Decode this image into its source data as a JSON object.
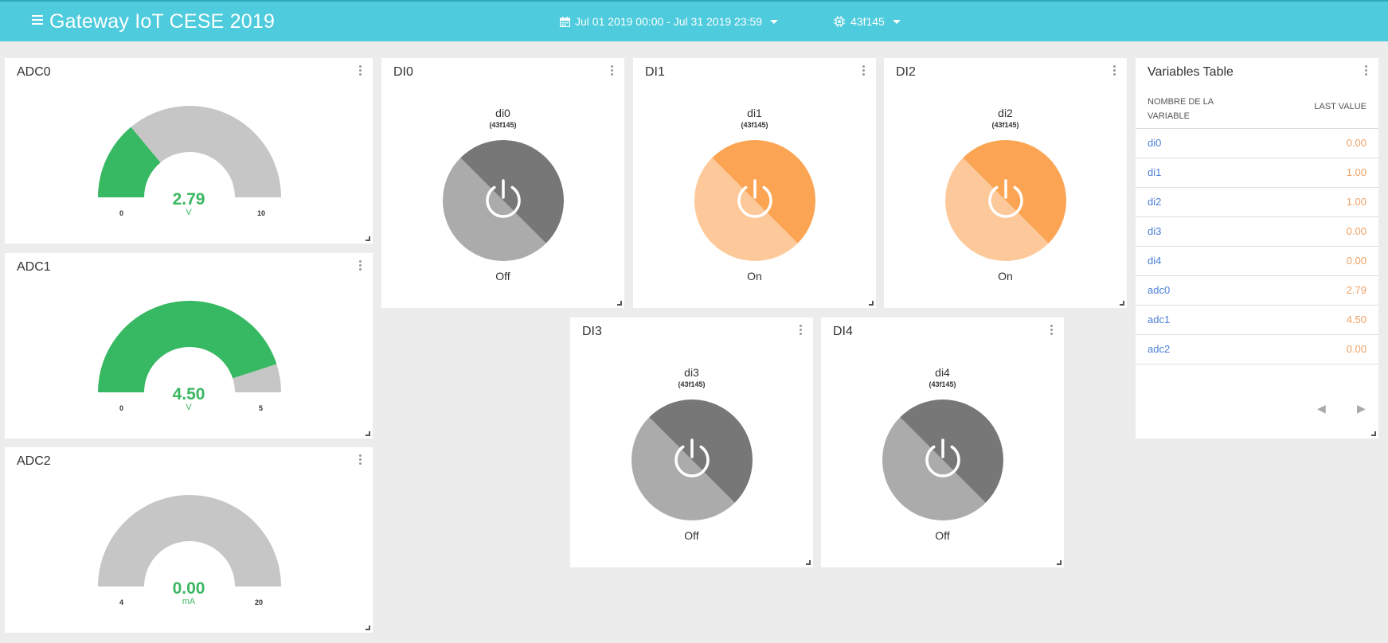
{
  "header": {
    "title": "Gateway IoT CESE 2019",
    "date_range": "Jul 01 2019 00:00 - Jul 31 2019 23:59",
    "device": "43f145"
  },
  "colors": {
    "header_bg": "#4ecbdc",
    "gauge_fill": "#37b862",
    "gauge_track": "#c6c6c6",
    "switch_on_dark": "#fba554",
    "switch_on_light": "#fdc99a",
    "switch_off_dark": "#777777",
    "switch_off_light": "#ababab",
    "link": "#4a7fd6",
    "value": "#f0a063"
  },
  "gauges": [
    {
      "title": "ADC0",
      "value": "2.79",
      "unit": "V",
      "min": "0",
      "max": "10",
      "fraction": 0.279
    },
    {
      "title": "ADC1",
      "value": "4.50",
      "unit": "V",
      "min": "0",
      "max": "5",
      "fraction": 0.9
    },
    {
      "title": "ADC2",
      "value": "0.00",
      "unit": "mA",
      "min": "4",
      "max": "20",
      "fraction": 0
    }
  ],
  "switches": [
    {
      "title": "DI0",
      "name": "di0",
      "device": "(43f145)",
      "state": "Off",
      "on": false
    },
    {
      "title": "DI1",
      "name": "di1",
      "device": "(43f145)",
      "state": "On",
      "on": true
    },
    {
      "title": "DI2",
      "name": "di2",
      "device": "(43f145)",
      "state": "On",
      "on": true
    },
    {
      "title": "DI3",
      "name": "di3",
      "device": "(43f145)",
      "state": "Off",
      "on": false
    },
    {
      "title": "DI4",
      "name": "di4",
      "device": "(43f145)",
      "state": "Off",
      "on": false
    }
  ],
  "variables_table": {
    "title": "Variables Table",
    "col_name": "Nombre de la variable",
    "col_value": "Last value",
    "rows": [
      {
        "name": "di0",
        "value": "0.00"
      },
      {
        "name": "di1",
        "value": "1.00"
      },
      {
        "name": "di2",
        "value": "1.00"
      },
      {
        "name": "di3",
        "value": "0.00"
      },
      {
        "name": "di4",
        "value": "0.00"
      },
      {
        "name": "adc0",
        "value": "2.79"
      },
      {
        "name": "adc1",
        "value": "4.50"
      },
      {
        "name": "adc2",
        "value": "0.00"
      }
    ],
    "prev_icon": "caret-left-icon",
    "next_icon": "caret-right-icon"
  }
}
